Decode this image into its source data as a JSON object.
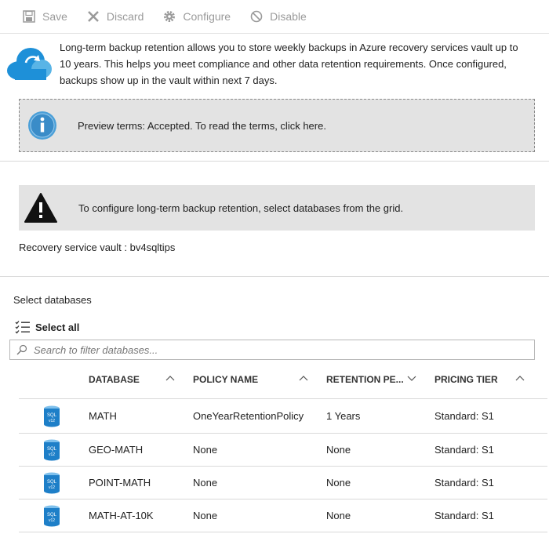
{
  "toolbar": {
    "save": "Save",
    "discard": "Discard",
    "configure": "Configure",
    "disable": "Disable"
  },
  "intro": {
    "text": "Long-term backup retention allows you to store weekly backups in Azure recovery services vault up to 10 years. This helps you meet compliance and other data retention requirements. Once configured, backups show up in the vault within next 7 days."
  },
  "info_banner": {
    "text": "Preview terms: Accepted. To read the terms, click here."
  },
  "warning_banner": {
    "text": "To configure long-term backup retention, select databases from the grid."
  },
  "vault": {
    "text": "Recovery service vault : bv4sqltips"
  },
  "select": {
    "label": "Select databases",
    "select_all": "Select all",
    "search_placeholder": "Search to filter databases..."
  },
  "table": {
    "columns": [
      "DATABASE",
      "POLICY NAME",
      "RETENTION PE...",
      "PRICING TIER"
    ],
    "rows": [
      [
        "MATH",
        "OneYearRetentionPolicy",
        "1 Years",
        "Standard: S1"
      ],
      [
        "GEO-MATH",
        "None",
        "None",
        "Standard: S1"
      ],
      [
        "POINT-MATH",
        "None",
        "None",
        "Standard: S1"
      ],
      [
        "MATH-AT-10K",
        "None",
        "None",
        "Standard: S1"
      ]
    ]
  },
  "colors": {
    "accent": "#1e90d8",
    "banner_bg": "#e3e3e3",
    "disabled_text": "#9a9a9a"
  },
  "icons": [
    "save-icon",
    "discard-icon",
    "configure-icon",
    "disable-icon",
    "cloud-icon",
    "info-icon",
    "warning-icon",
    "select-all-icon",
    "search-icon",
    "sql-database-icon"
  ]
}
